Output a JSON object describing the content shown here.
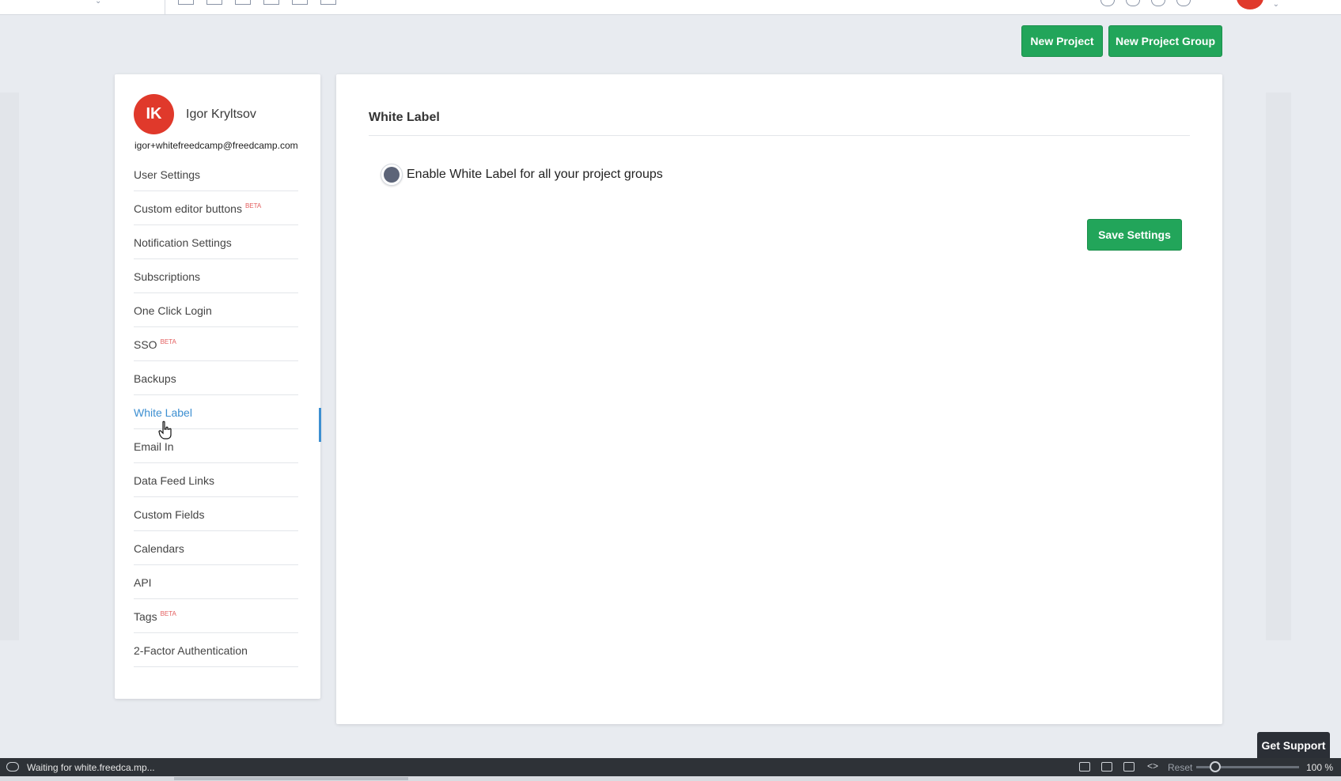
{
  "header": {
    "new_project_label": "New Project",
    "new_project_group_label": "New Project Group"
  },
  "profile": {
    "initials": "IK",
    "name": "Igor Kryltsov",
    "email": "igor+whitefreedcamp@freedcamp.com",
    "avatar_color": "#e0392b"
  },
  "sidebar": {
    "items": [
      {
        "label": "User Settings",
        "badge": ""
      },
      {
        "label": "Custom editor buttons",
        "badge": "BETA"
      },
      {
        "label": "Notification Settings",
        "badge": ""
      },
      {
        "label": "Subscriptions",
        "badge": ""
      },
      {
        "label": "One Click Login",
        "badge": ""
      },
      {
        "label": "SSO",
        "badge": "BETA"
      },
      {
        "label": "Backups",
        "badge": ""
      },
      {
        "label": "White Label",
        "badge": "",
        "active": true
      },
      {
        "label": "Email In",
        "badge": ""
      },
      {
        "label": "Data Feed Links",
        "badge": ""
      },
      {
        "label": "Custom Fields",
        "badge": ""
      },
      {
        "label": "Calendars",
        "badge": ""
      },
      {
        "label": "API",
        "badge": ""
      },
      {
        "label": "Tags",
        "badge": "BETA"
      },
      {
        "label": "2-Factor Authentication",
        "badge": ""
      }
    ]
  },
  "main": {
    "title": "White Label",
    "toggle_label": "Enable White Label for all your project groups",
    "toggle_on": false,
    "save_label": "Save Settings"
  },
  "support": {
    "label": "Get Support"
  },
  "statusbar": {
    "status_text": "Waiting for white.freedca.mp...",
    "reset_label": "Reset",
    "zoom": "100 %"
  },
  "colors": {
    "accent_green": "#22a55a",
    "active_blue": "#3d8fd1",
    "beta_red": "#e35d5d"
  }
}
